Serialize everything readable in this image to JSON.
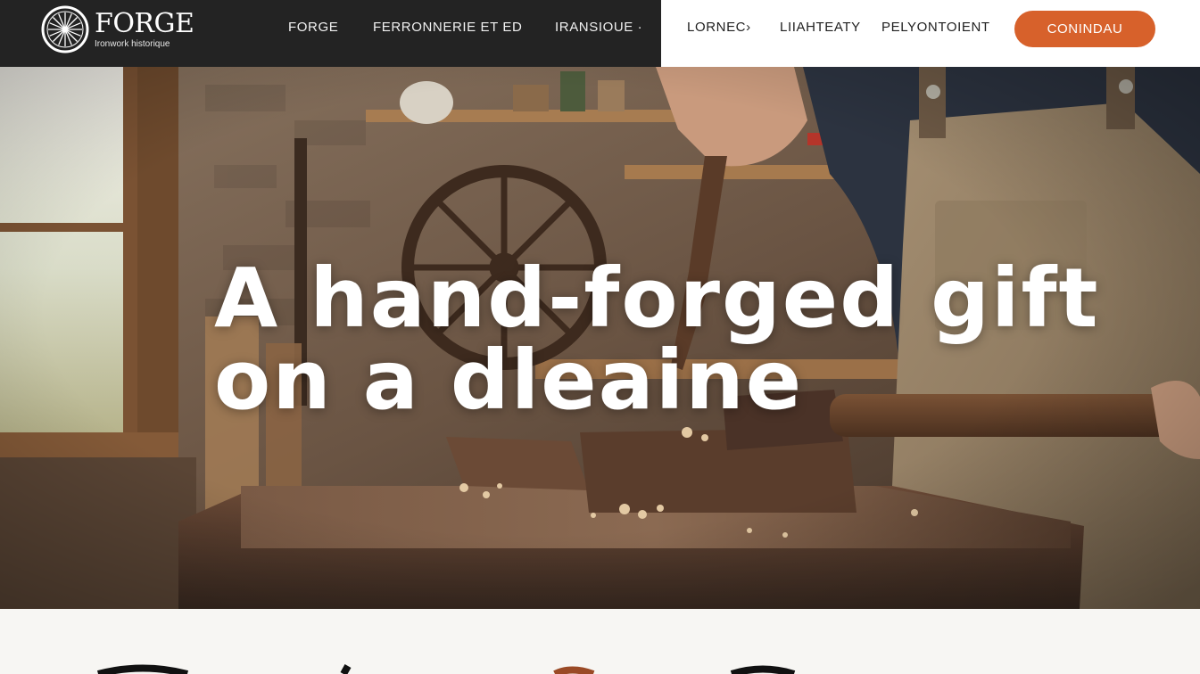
{
  "brand": {
    "name": "FORGE",
    "tagline": "Ironwork historique"
  },
  "nav": {
    "links": [
      "FORGE",
      "FERRONNERIE ET ED",
      "IRANSIOUE ·",
      "LORNEC›",
      "LIIAHTEATY",
      "PELYONTOIENT"
    ],
    "cta_label": "CONINDAU"
  },
  "hero": {
    "heading_line1": "A hand-forged gift",
    "heading_line2": "on a dleaine"
  },
  "colors": {
    "nav_dark": "#232323",
    "nav_light": "#ffffff",
    "accent": "#d7612b",
    "hero_text": "#ffffff"
  },
  "icons": {
    "logo_emblem": "wheel-emblem-icon"
  }
}
